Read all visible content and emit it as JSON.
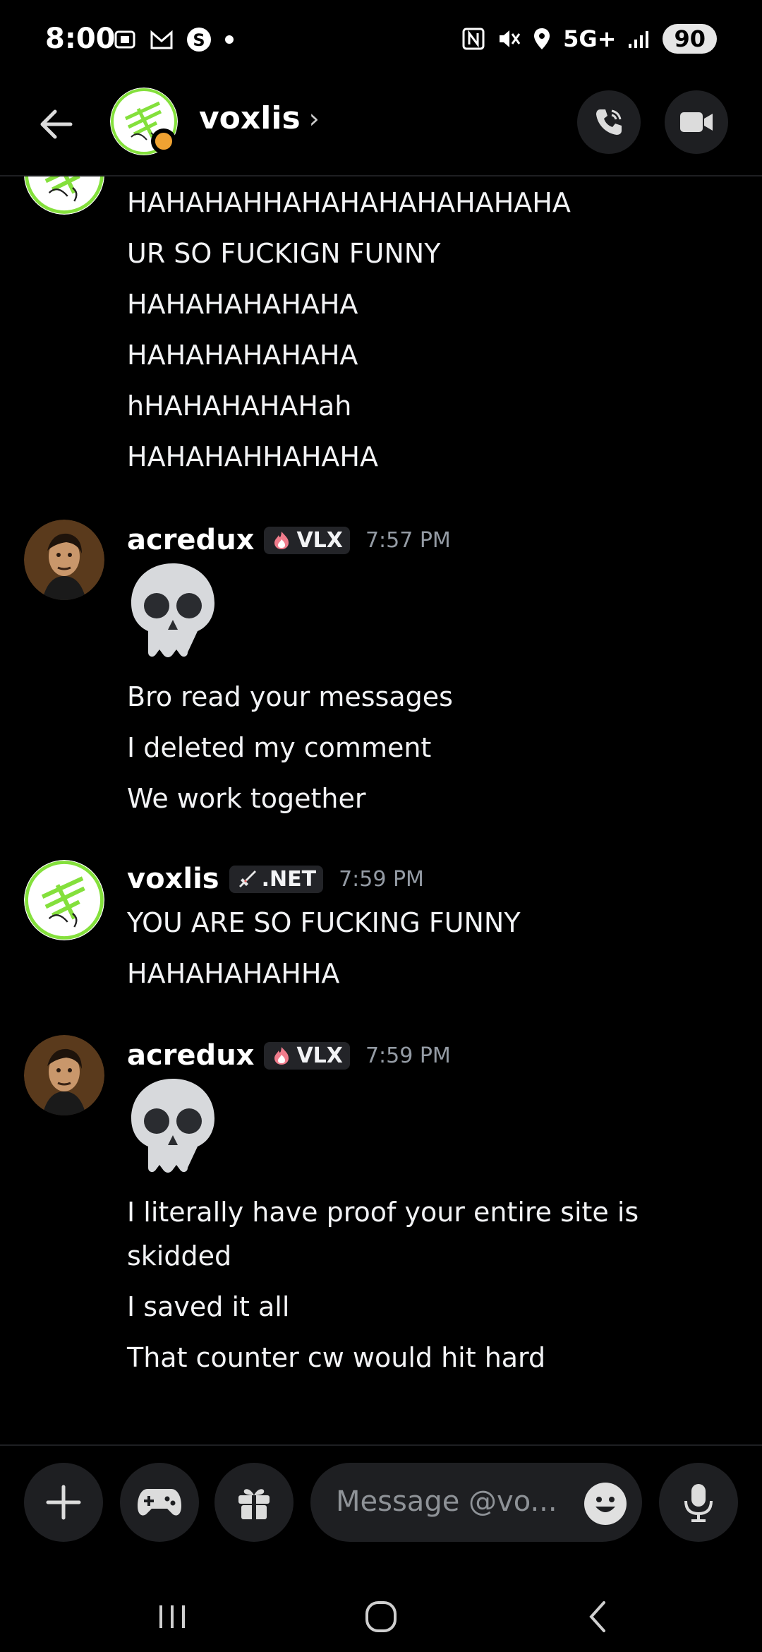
{
  "status_bar": {
    "time": "8:00",
    "network": "5G+",
    "battery": "90"
  },
  "header": {
    "title": "voxlis",
    "chevron": "›"
  },
  "messages": [
    {
      "lines": [
        "HAHAHAHHAHAHAHAHAHAHAHA",
        "UR SO FUCKIGN FUNNY",
        "HAHAHAHAHAHA",
        "HAHAHAHAHAHA",
        "hHAHAHAHAHah",
        "HAHAHAHHAHAHA"
      ]
    },
    {
      "author": "acredux",
      "tag": "VLX",
      "time": "7:57 PM",
      "emoji": "skull",
      "lines": [
        "Bro read your messages",
        "I deleted my comment",
        "We work together"
      ]
    },
    {
      "author": "voxlis",
      "tag": ".NET",
      "time": "7:59 PM",
      "lines": [
        "YOU ARE SO FUCKING FUNNY",
        "HAHAHAHAHHA"
      ]
    },
    {
      "author": "acredux",
      "tag": "VLX",
      "time": "7:59 PM",
      "emoji": "skull",
      "lines": [
        "I literally have proof your entire site is",
        "skidded",
        "I saved it all",
        "That counter cw would hit hard"
      ]
    }
  ],
  "composer": {
    "placeholder": "Message @vo..."
  },
  "colors": {
    "background": "#000000",
    "surface": "#1e1f22",
    "accent_green": "#84e03c",
    "timestamp": "#949ba4"
  }
}
